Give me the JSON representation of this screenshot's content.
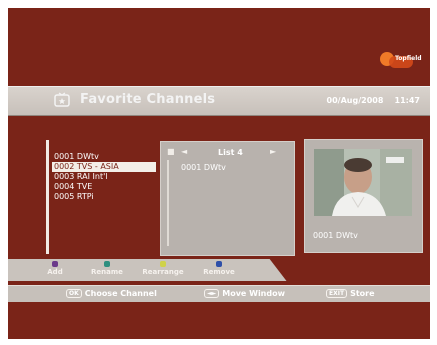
{
  "brand": {
    "logo_text": "Topfield"
  },
  "header": {
    "title": "Favorite Channels",
    "date": "00/Aug/2008",
    "time": "11:47"
  },
  "channel_list": [
    {
      "label": "0001 DWtv",
      "selected": false
    },
    {
      "label": "0002 TVS - ASIA",
      "selected": true
    },
    {
      "label": "0003 RAI Int'l",
      "selected": false
    },
    {
      "label": "0004 TVE",
      "selected": false
    },
    {
      "label": "0005 RTPi",
      "selected": false
    }
  ],
  "favorite_panel": {
    "list_name": "List 4",
    "channels": [
      "0001 DWtv"
    ]
  },
  "preview": {
    "caption": "0001 DWtv"
  },
  "actions": [
    {
      "label": "Add",
      "color": "#6b3a8a"
    },
    {
      "label": "Rename",
      "color": "#2e8f7f"
    },
    {
      "label": "Rearrange",
      "color": "#cfd24a"
    },
    {
      "label": "Remove",
      "color": "#2e4fa8"
    }
  ],
  "help": [
    {
      "key": "OK",
      "label": "Choose Channel"
    },
    {
      "key": "◄►",
      "label": "Move Window"
    },
    {
      "key": "EXIT",
      "label": "Store"
    }
  ]
}
